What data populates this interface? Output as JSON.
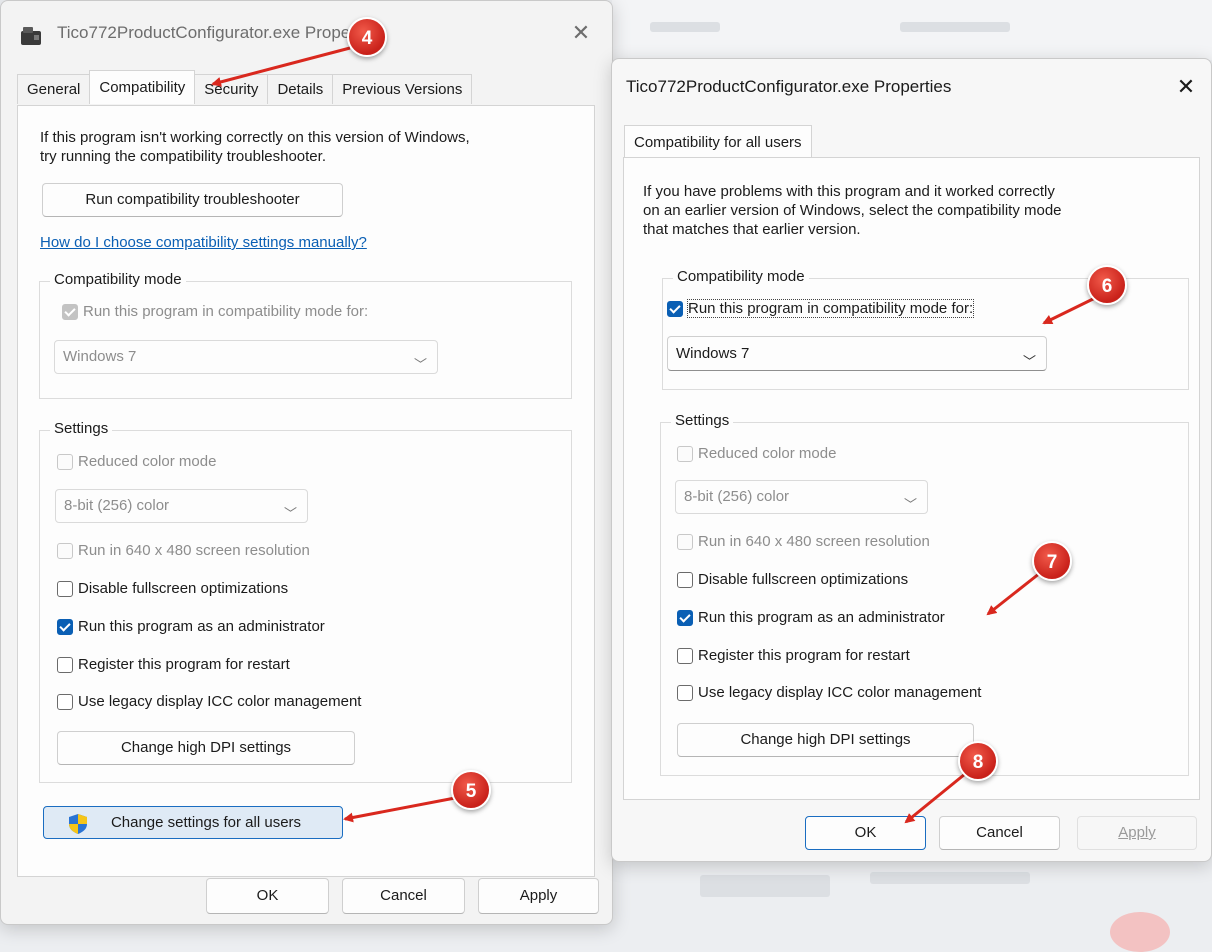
{
  "window1": {
    "title": "Tico772ProductConfigurator.exe Properties",
    "tabs": [
      "General",
      "Compatibility",
      "Security",
      "Details",
      "Previous Versions"
    ],
    "intro_line1": "If this program isn't working correctly on this version of Windows,",
    "intro_line2": "try running the compatibility troubleshooter.",
    "troubleshooter_button": "Run compatibility troubleshooter",
    "help_link": "How do I choose compatibility settings manually?",
    "compat_group": "Compatibility mode",
    "compat_checkbox": "Run this program in compatibility mode for:",
    "compat_select": "Windows 7",
    "settings_group": "Settings",
    "reduced_color": "Reduced color mode",
    "color_select": "8-bit (256) color",
    "res_640": "Run in 640 x 480 screen resolution",
    "disable_fullscreen": "Disable fullscreen optimizations",
    "run_admin": "Run this program as an administrator",
    "register_restart": "Register this program for restart",
    "legacy_icc": "Use legacy display ICC color management",
    "dpi_button": "Change high DPI settings",
    "all_users_button": "Change settings for all users",
    "ok": "OK",
    "cancel": "Cancel",
    "apply": "Apply"
  },
  "window2": {
    "title": "Tico772ProductConfigurator.exe Properties",
    "tab": "Compatibility for all users",
    "intro_line1": "If you have problems with this program and it worked correctly",
    "intro_line2": "on an earlier version of Windows, select the compatibility mode",
    "intro_line3": "that matches that earlier version.",
    "compat_group": "Compatibility mode",
    "compat_checkbox": "Run this program in compatibility mode for:",
    "compat_select": "Windows 7",
    "settings_group": "Settings",
    "reduced_color": "Reduced color mode",
    "color_select": "8-bit (256) color",
    "res_640": "Run in 640 x 480 screen resolution",
    "disable_fullscreen": "Disable fullscreen optimizations",
    "run_admin": "Run this program as an administrator",
    "register_restart": "Register this program for restart",
    "legacy_icc": "Use legacy display ICC color management",
    "dpi_button": "Change high DPI settings",
    "ok": "OK",
    "cancel": "Cancel",
    "apply": "Apply"
  },
  "annotations": [
    "4",
    "5",
    "6",
    "7",
    "8"
  ],
  "colors": {
    "accent": "#0a5fb4",
    "badge": "#d9281e"
  }
}
